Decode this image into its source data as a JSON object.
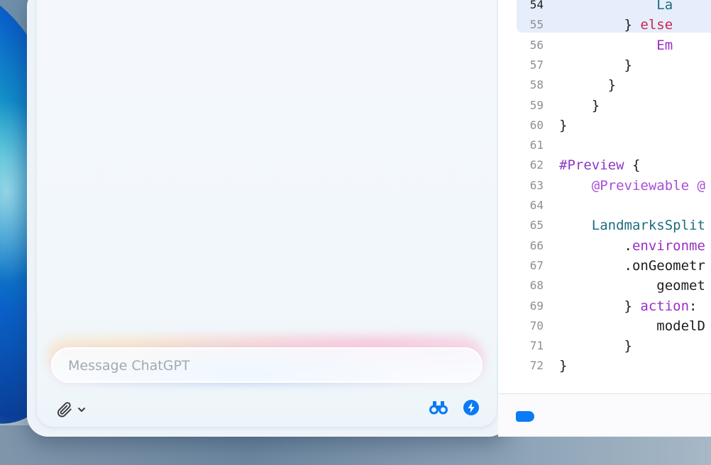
{
  "composer": {
    "placeholder": "Message ChatGPT",
    "value": ""
  },
  "icons": {
    "attach": "paperclip-icon",
    "attach_menu": "chevron-down-icon",
    "search": "binoculars-icon",
    "reason": "lightning-bolt-icon",
    "tag": "tag-icon"
  },
  "colors": {
    "accent": "#0a7af5",
    "keyword": "#c8254f",
    "macro": "#8e38c4",
    "type": "#1d6c7f",
    "attribute": "#a84ed6"
  },
  "editor": {
    "current_line": "54",
    "lines": [
      {
        "n": "54",
        "tokens": [
          {
            "t": "            La",
            "c": "teal"
          }
        ]
      },
      {
        "n": "55",
        "tokens": [
          {
            "t": "        } ",
            "c": "plain"
          },
          {
            "t": "else",
            "c": "kw"
          }
        ]
      },
      {
        "n": "56",
        "tokens": [
          {
            "t": "            ",
            "c": "plain"
          },
          {
            "t": "Em",
            "c": "purple"
          }
        ]
      },
      {
        "n": "57",
        "tokens": [
          {
            "t": "        }",
            "c": "plain"
          }
        ]
      },
      {
        "n": "58",
        "tokens": [
          {
            "t": "      }",
            "c": "plain"
          }
        ]
      },
      {
        "n": "59",
        "tokens": [
          {
            "t": "    }",
            "c": "plain"
          }
        ]
      },
      {
        "n": "60",
        "tokens": [
          {
            "t": "}",
            "c": "plain"
          }
        ]
      },
      {
        "n": "61",
        "tokens": [
          {
            "t": "",
            "c": "plain"
          }
        ]
      },
      {
        "n": "62",
        "tokens": [
          {
            "t": "#Preview",
            "c": "macro"
          },
          {
            "t": " {",
            "c": "plain"
          }
        ]
      },
      {
        "n": "63",
        "tokens": [
          {
            "t": "    ",
            "c": "plain"
          },
          {
            "t": "@Previewable @",
            "c": "attr"
          }
        ]
      },
      {
        "n": "64",
        "tokens": [
          {
            "t": "",
            "c": "plain"
          }
        ]
      },
      {
        "n": "65",
        "tokens": [
          {
            "t": "    ",
            "c": "plain"
          },
          {
            "t": "LandmarksSplit",
            "c": "teal"
          }
        ]
      },
      {
        "n": "66",
        "tokens": [
          {
            "t": "        .",
            "c": "plain"
          },
          {
            "t": "environme",
            "c": "purple"
          }
        ]
      },
      {
        "n": "67",
        "tokens": [
          {
            "t": "        .onGeometr",
            "c": "plain"
          }
        ]
      },
      {
        "n": "68",
        "tokens": [
          {
            "t": "            geomet",
            "c": "plain"
          }
        ]
      },
      {
        "n": "69",
        "tokens": [
          {
            "t": "        } ",
            "c": "plain"
          },
          {
            "t": "action",
            "c": "purple"
          },
          {
            "t": ":",
            "c": "plain"
          }
        ]
      },
      {
        "n": "70",
        "tokens": [
          {
            "t": "            modelD",
            "c": "plain"
          }
        ]
      },
      {
        "n": "71",
        "tokens": [
          {
            "t": "        }",
            "c": "plain"
          }
        ]
      },
      {
        "n": "72",
        "tokens": [
          {
            "t": "}",
            "c": "plain"
          }
        ]
      }
    ]
  }
}
